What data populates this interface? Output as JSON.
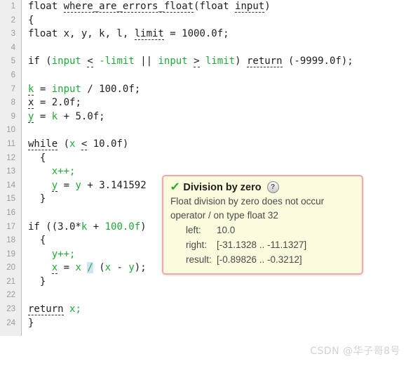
{
  "editor": {
    "language": "c",
    "gutter_bg": "#eeeeee",
    "identifier_color": "#1faa37",
    "highlight_color": "#cfe3f5",
    "lines": [
      {
        "no": "1",
        "segments": [
          {
            "t": "float ",
            "c": "plain"
          },
          {
            "t": "where_are_errors_float",
            "c": "plain decl"
          },
          {
            "t": "(float ",
            "c": "plain"
          },
          {
            "t": "input",
            "c": "plain decl"
          },
          {
            "t": ")",
            "c": "plain"
          }
        ]
      },
      {
        "no": "2",
        "segments": [
          {
            "t": "{",
            "c": "plain"
          }
        ]
      },
      {
        "no": "3",
        "segments": [
          {
            "t": "float x, y, k, l, ",
            "c": "plain"
          },
          {
            "t": "limit",
            "c": "plain decl"
          },
          {
            "t": " = 1000.0f;",
            "c": "plain"
          }
        ]
      },
      {
        "no": "4",
        "segments": []
      },
      {
        "no": "5",
        "segments": [
          {
            "t": "if (",
            "c": "plain"
          },
          {
            "t": "input",
            "c": "id"
          },
          {
            "t": " ",
            "c": "plain"
          },
          {
            "t": "<",
            "c": "plain decl"
          },
          {
            "t": " ",
            "c": "plain"
          },
          {
            "t": "-limit",
            "c": "id"
          },
          {
            "t": " || ",
            "c": "plain"
          },
          {
            "t": "input",
            "c": "id"
          },
          {
            "t": " ",
            "c": "plain"
          },
          {
            "t": ">",
            "c": "plain decl"
          },
          {
            "t": " ",
            "c": "plain"
          },
          {
            "t": "limit",
            "c": "id"
          },
          {
            "t": ") ",
            "c": "plain"
          },
          {
            "t": "return",
            "c": "plain decl"
          },
          {
            "t": " (-9999.0f);",
            "c": "plain"
          }
        ]
      },
      {
        "no": "6",
        "segments": []
      },
      {
        "no": "7",
        "segments": [
          {
            "t": "k",
            "c": "id decl"
          },
          {
            "t": " = ",
            "c": "plain"
          },
          {
            "t": "input",
            "c": "id"
          },
          {
            "t": " / ",
            "c": "plain"
          },
          {
            "t": "100.0f;",
            "c": "plain"
          }
        ]
      },
      {
        "no": "8",
        "segments": [
          {
            "t": "x",
            "c": "plain decl"
          },
          {
            "t": " = 2.0f;",
            "c": "plain"
          }
        ]
      },
      {
        "no": "9",
        "segments": [
          {
            "t": "y",
            "c": "id decl"
          },
          {
            "t": " = ",
            "c": "plain"
          },
          {
            "t": "k",
            "c": "id"
          },
          {
            "t": " + 5.0f;",
            "c": "plain"
          }
        ]
      },
      {
        "no": "10",
        "segments": []
      },
      {
        "no": "11",
        "segments": [
          {
            "t": "while",
            "c": "plain decl"
          },
          {
            "t": " (",
            "c": "plain"
          },
          {
            "t": "x",
            "c": "id"
          },
          {
            "t": " ",
            "c": "plain"
          },
          {
            "t": "<",
            "c": "plain decl"
          },
          {
            "t": " 10.0f)",
            "c": "plain"
          }
        ]
      },
      {
        "no": "12",
        "segments": [
          {
            "t": "  {",
            "c": "plain"
          }
        ]
      },
      {
        "no": "13",
        "segments": [
          {
            "t": "    ",
            "c": "plain"
          },
          {
            "t": "x++;",
            "c": "id"
          }
        ]
      },
      {
        "no": "14",
        "segments": [
          {
            "t": "    ",
            "c": "plain"
          },
          {
            "t": "y",
            "c": "id decl"
          },
          {
            "t": " = ",
            "c": "plain"
          },
          {
            "t": "y",
            "c": "id"
          },
          {
            "t": " + ",
            "c": "plain"
          },
          {
            "t": "3.141592",
            "c": "plain"
          }
        ]
      },
      {
        "no": "15",
        "segments": [
          {
            "t": "  }",
            "c": "plain"
          }
        ]
      },
      {
        "no": "16",
        "segments": []
      },
      {
        "no": "17",
        "segments": [
          {
            "t": "if ((3.0*",
            "c": "plain"
          },
          {
            "t": "k",
            "c": "id"
          },
          {
            "t": " + ",
            "c": "plain"
          },
          {
            "t": "100.0f",
            "c": "id"
          },
          {
            "t": ")",
            "c": "plain"
          }
        ]
      },
      {
        "no": "18",
        "segments": [
          {
            "t": "  {",
            "c": "plain"
          }
        ]
      },
      {
        "no": "19",
        "segments": [
          {
            "t": "    ",
            "c": "plain"
          },
          {
            "t": "y++;",
            "c": "id"
          }
        ]
      },
      {
        "no": "20",
        "segments": [
          {
            "t": "    ",
            "c": "plain"
          },
          {
            "t": "x",
            "c": "id decl"
          },
          {
            "t": " = ",
            "c": "plain"
          },
          {
            "t": "x",
            "c": "id"
          },
          {
            "t": " ",
            "c": "plain"
          },
          {
            "t": "/",
            "c": "hl"
          },
          {
            "t": " (",
            "c": "plain"
          },
          {
            "t": "x",
            "c": "id"
          },
          {
            "t": " - ",
            "c": "plain"
          },
          {
            "t": "y",
            "c": "id"
          },
          {
            "t": ");",
            "c": "plain"
          }
        ]
      },
      {
        "no": "21",
        "segments": [
          {
            "t": "  }",
            "c": "plain"
          }
        ]
      },
      {
        "no": "22",
        "segments": []
      },
      {
        "no": "23",
        "segments": [
          {
            "t": "return",
            "c": "plain decl"
          },
          {
            "t": " ",
            "c": "plain"
          },
          {
            "t": "x;",
            "c": "id"
          }
        ]
      },
      {
        "no": "24",
        "segments": [
          {
            "t": "}",
            "c": "plain"
          }
        ]
      }
    ]
  },
  "tooltip": {
    "check_glyph": "✓",
    "title": "Division by zero",
    "help_glyph": "?",
    "message_line_1": "Float division by zero does not occur",
    "message_line_2": "operator / on type float 32",
    "rows": [
      {
        "label": "left:",
        "value": "10.0"
      },
      {
        "label": "right:",
        "value": "[-31.1328 .. -11.1327]"
      },
      {
        "label": "result:",
        "value": "[-0.89826 .. -0.3212]"
      }
    ],
    "border_color": "#f0a8ac",
    "bg_color": "#fdfbdd"
  },
  "watermark": {
    "text": "CSDN @华子哥8号"
  }
}
